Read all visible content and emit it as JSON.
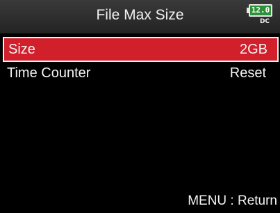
{
  "header": {
    "title": "File Max Size",
    "battery": {
      "voltage": "12.0",
      "source": "DC",
      "color": "#2f8f3a",
      "icon": "battery-icon"
    }
  },
  "menu": {
    "items": [
      {
        "label": "Size",
        "value": "2GB",
        "selected": true
      },
      {
        "label": "Time Counter",
        "value": "Reset",
        "selected": false
      }
    ]
  },
  "footer": {
    "hint": "MENU : Return"
  },
  "colors": {
    "selection": "#d21f2c",
    "background": "#000000",
    "text": "#ffffff"
  }
}
